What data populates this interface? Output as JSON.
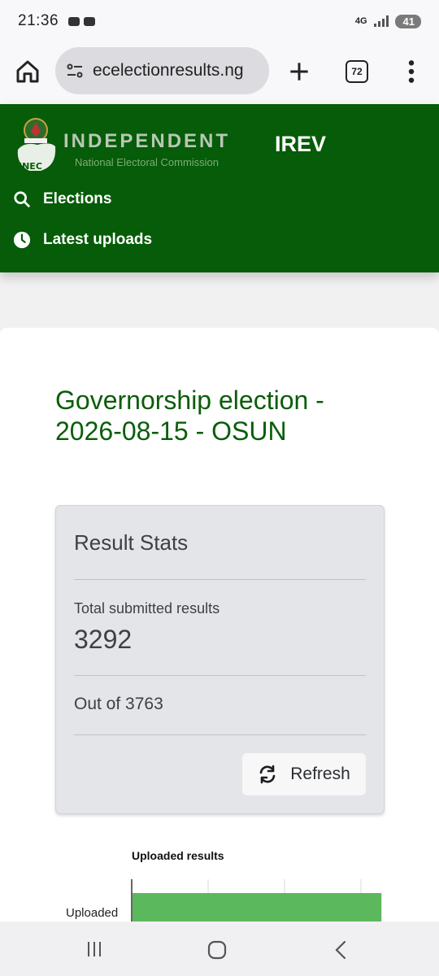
{
  "status": {
    "time": "21:36",
    "network": "4G",
    "battery": "41"
  },
  "browser": {
    "url": "ecelectionresults.ng",
    "tab_count": "72"
  },
  "header": {
    "logo_word": "INDEPENDENT",
    "logo_sub": "National Electoral Commission",
    "logo_badge": "INEC",
    "brand": "IREV",
    "nav": {
      "elections": "Elections",
      "latest": "Latest uploads"
    }
  },
  "main": {
    "title": "Governorship election - 2026-08-15 - OSUN",
    "stats": {
      "heading": "Result Stats",
      "total_label": "Total submitted results",
      "total_value": "3292",
      "out_of": "Out of 3763",
      "refresh_label": "Refresh"
    }
  },
  "colors": {
    "header_green": "#065c08",
    "title_green": "#0a5d0a",
    "bar_green": "#5cb85c"
  },
  "chart_data": {
    "type": "bar",
    "orientation": "horizontal",
    "title": "Uploaded results",
    "categories": [
      "Uploaded"
    ],
    "values": [
      3292
    ],
    "xlim": [
      0,
      3763
    ],
    "grid": true
  }
}
